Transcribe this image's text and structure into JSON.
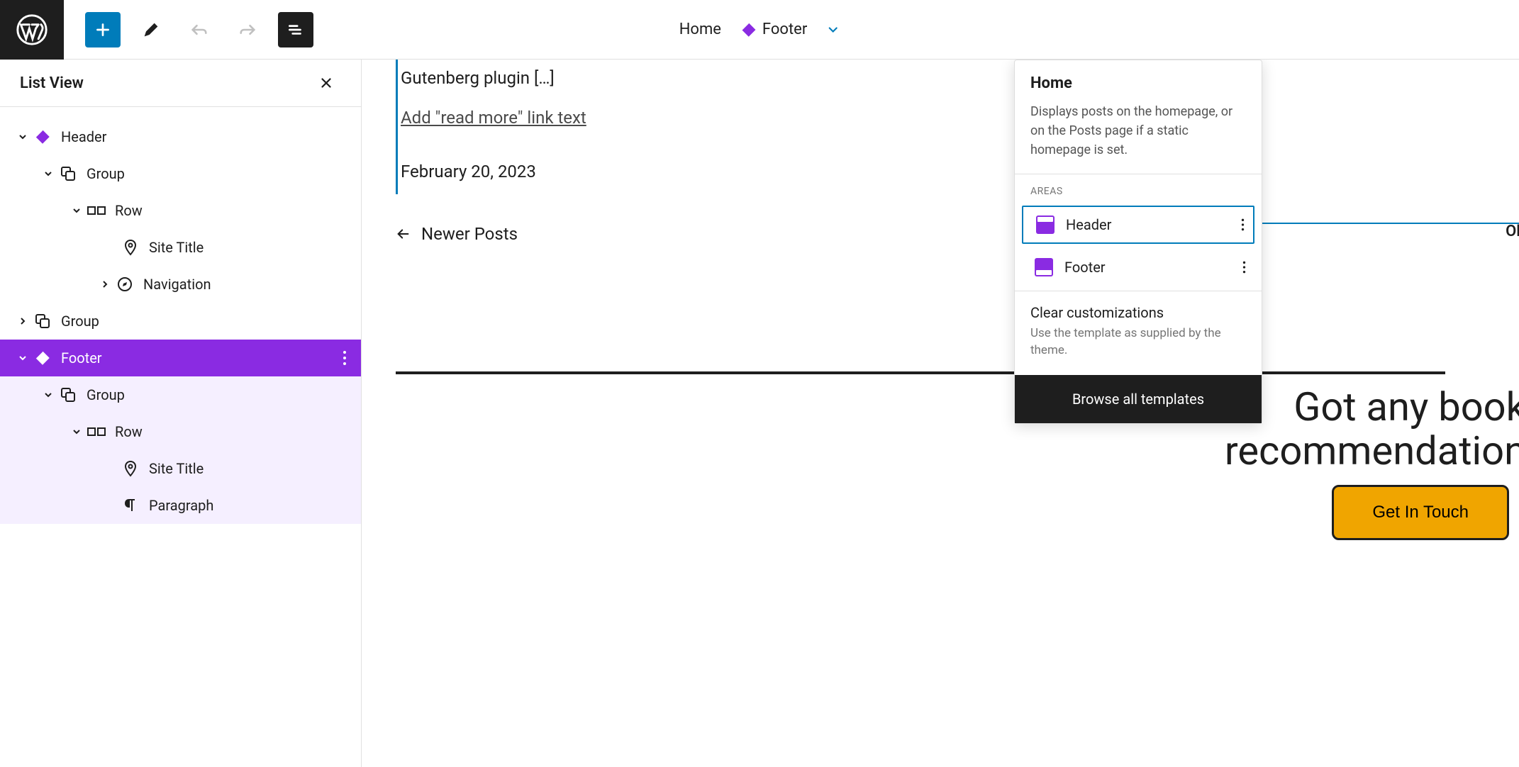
{
  "toolbar": {
    "breadcrumb_home": "Home",
    "breadcrumb_current": "Footer"
  },
  "list_view": {
    "title": "List View",
    "items": {
      "header": "Header",
      "group1": "Group",
      "row1": "Row",
      "site_title1": "Site Title",
      "navigation": "Navigation",
      "group2": "Group",
      "footer": "Footer",
      "group3": "Group",
      "row2": "Row",
      "site_title2": "Site Title",
      "paragraph": "Paragraph"
    }
  },
  "canvas": {
    "excerpt": "Gutenberg plugin […]",
    "readmore": "Add \"read more\" link text",
    "date": "February 20, 2023",
    "newer_posts": "Newer Posts",
    "footer_ol": "Ol",
    "footer_heading_l1": "Got any book",
    "footer_heading_l2": "recommendation",
    "cta": "Get In Touch"
  },
  "popover": {
    "title": "Home",
    "description": "Displays posts on the homepage, or on the Posts page if a static homepage is set.",
    "areas_label": "AREAS",
    "area_header": "Header",
    "area_footer": "Footer",
    "clear_title": "Clear customizations",
    "clear_desc": "Use the template as supplied by the theme.",
    "browse": "Browse all templates"
  }
}
